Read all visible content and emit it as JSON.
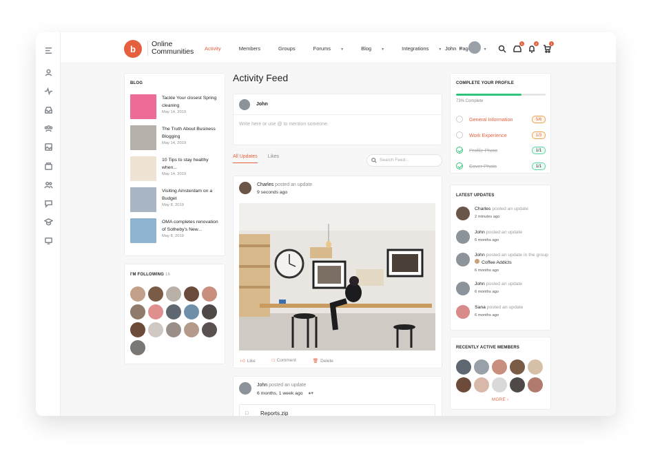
{
  "app": {
    "brand_line1": "Online",
    "brand_line2": "Communities",
    "logo_glyph": "b",
    "accent_color": "#e5603e"
  },
  "nav": {
    "items": [
      {
        "label": "Activity",
        "active": true,
        "dropdown": false
      },
      {
        "label": "Members",
        "active": false,
        "dropdown": false
      },
      {
        "label": "Groups",
        "active": false,
        "dropdown": false
      },
      {
        "label": "Forums",
        "active": false,
        "dropdown": true
      },
      {
        "label": "Blog",
        "active": false,
        "dropdown": true
      },
      {
        "label": "Integrations",
        "active": false,
        "dropdown": true
      },
      {
        "label": "Pages",
        "active": false,
        "dropdown": true
      }
    ],
    "user_name": "John",
    "messages_count": "1",
    "notifications_count": "2",
    "cart_count": "1"
  },
  "rail_icons": [
    "menu-icon",
    "profile-icon",
    "activity-icon",
    "inbox-icon",
    "groups-icon",
    "photos-icon",
    "folder-icon",
    "members-icon",
    "forums-icon",
    "courses-icon",
    "media-icon"
  ],
  "blog": {
    "title": "BLOG",
    "posts": [
      {
        "title": "Tackle Your closest Spring cleaning",
        "date": "May 14, 2019"
      },
      {
        "title": "The Truth About Business Blogging",
        "date": "May 14, 2019"
      },
      {
        "title": "10 Tips to stay healthy when...",
        "date": "May 14, 2019"
      },
      {
        "title": "Visiting Amsterdam on a Budget",
        "date": "May 8, 2019"
      },
      {
        "title": "OMA completes renovation of Sotheby's New...",
        "date": "May 8, 2019"
      }
    ]
  },
  "following": {
    "title": "I'M FOLLOWING",
    "count": "16"
  },
  "feed": {
    "title": "Activity Feed",
    "composer_user": "John",
    "composer_placeholder": "Write here or use @ to mention someone.",
    "tabs": [
      {
        "label": "All Updates",
        "active": true
      },
      {
        "label": "Likes",
        "active": false
      }
    ],
    "search_placeholder": "Search Feed...",
    "posts": [
      {
        "author": "Charles",
        "action": "posted an update",
        "time": "9 seconds ago"
      },
      {
        "author": "John",
        "action": "posted an update",
        "time": "6 months, 1 week ago",
        "attachment": "Reports.zip"
      }
    ],
    "actions": {
      "like": "Like",
      "comment": "Comment",
      "delete": "Delete"
    }
  },
  "profile": {
    "title": "COMPLETE YOUR PROFILE",
    "progress_percent": 73,
    "progress_label": "73% Complete",
    "progress_color": "#2fc47b",
    "items": [
      {
        "label": "General Information",
        "count": "5/6",
        "done": false
      },
      {
        "label": "Work Experience",
        "count": "1/3",
        "done": false
      },
      {
        "label": "Profile Photo",
        "count": "1/1",
        "done": true
      },
      {
        "label": "Cover Photo",
        "count": "1/1",
        "done": true
      }
    ]
  },
  "latest_updates": {
    "title": "LATEST UPDATES",
    "items": [
      {
        "name": "Charles",
        "action": "posted an update",
        "group": "",
        "time": "2 minutes ago"
      },
      {
        "name": "John",
        "action": "posted an update",
        "group": "",
        "time": "6 months ago"
      },
      {
        "name": "John",
        "action": "posted an update in the group",
        "group": "Coffee Addicts",
        "time": "6 months ago"
      },
      {
        "name": "John",
        "action": "posted an update",
        "group": "",
        "time": "6 months ago"
      },
      {
        "name": "Sana",
        "action": "posted an update",
        "group": "",
        "time": "6 months ago"
      }
    ]
  },
  "recent_members": {
    "title": "RECENTLY ACTIVE MEMBERS",
    "more_label": "MORE"
  }
}
